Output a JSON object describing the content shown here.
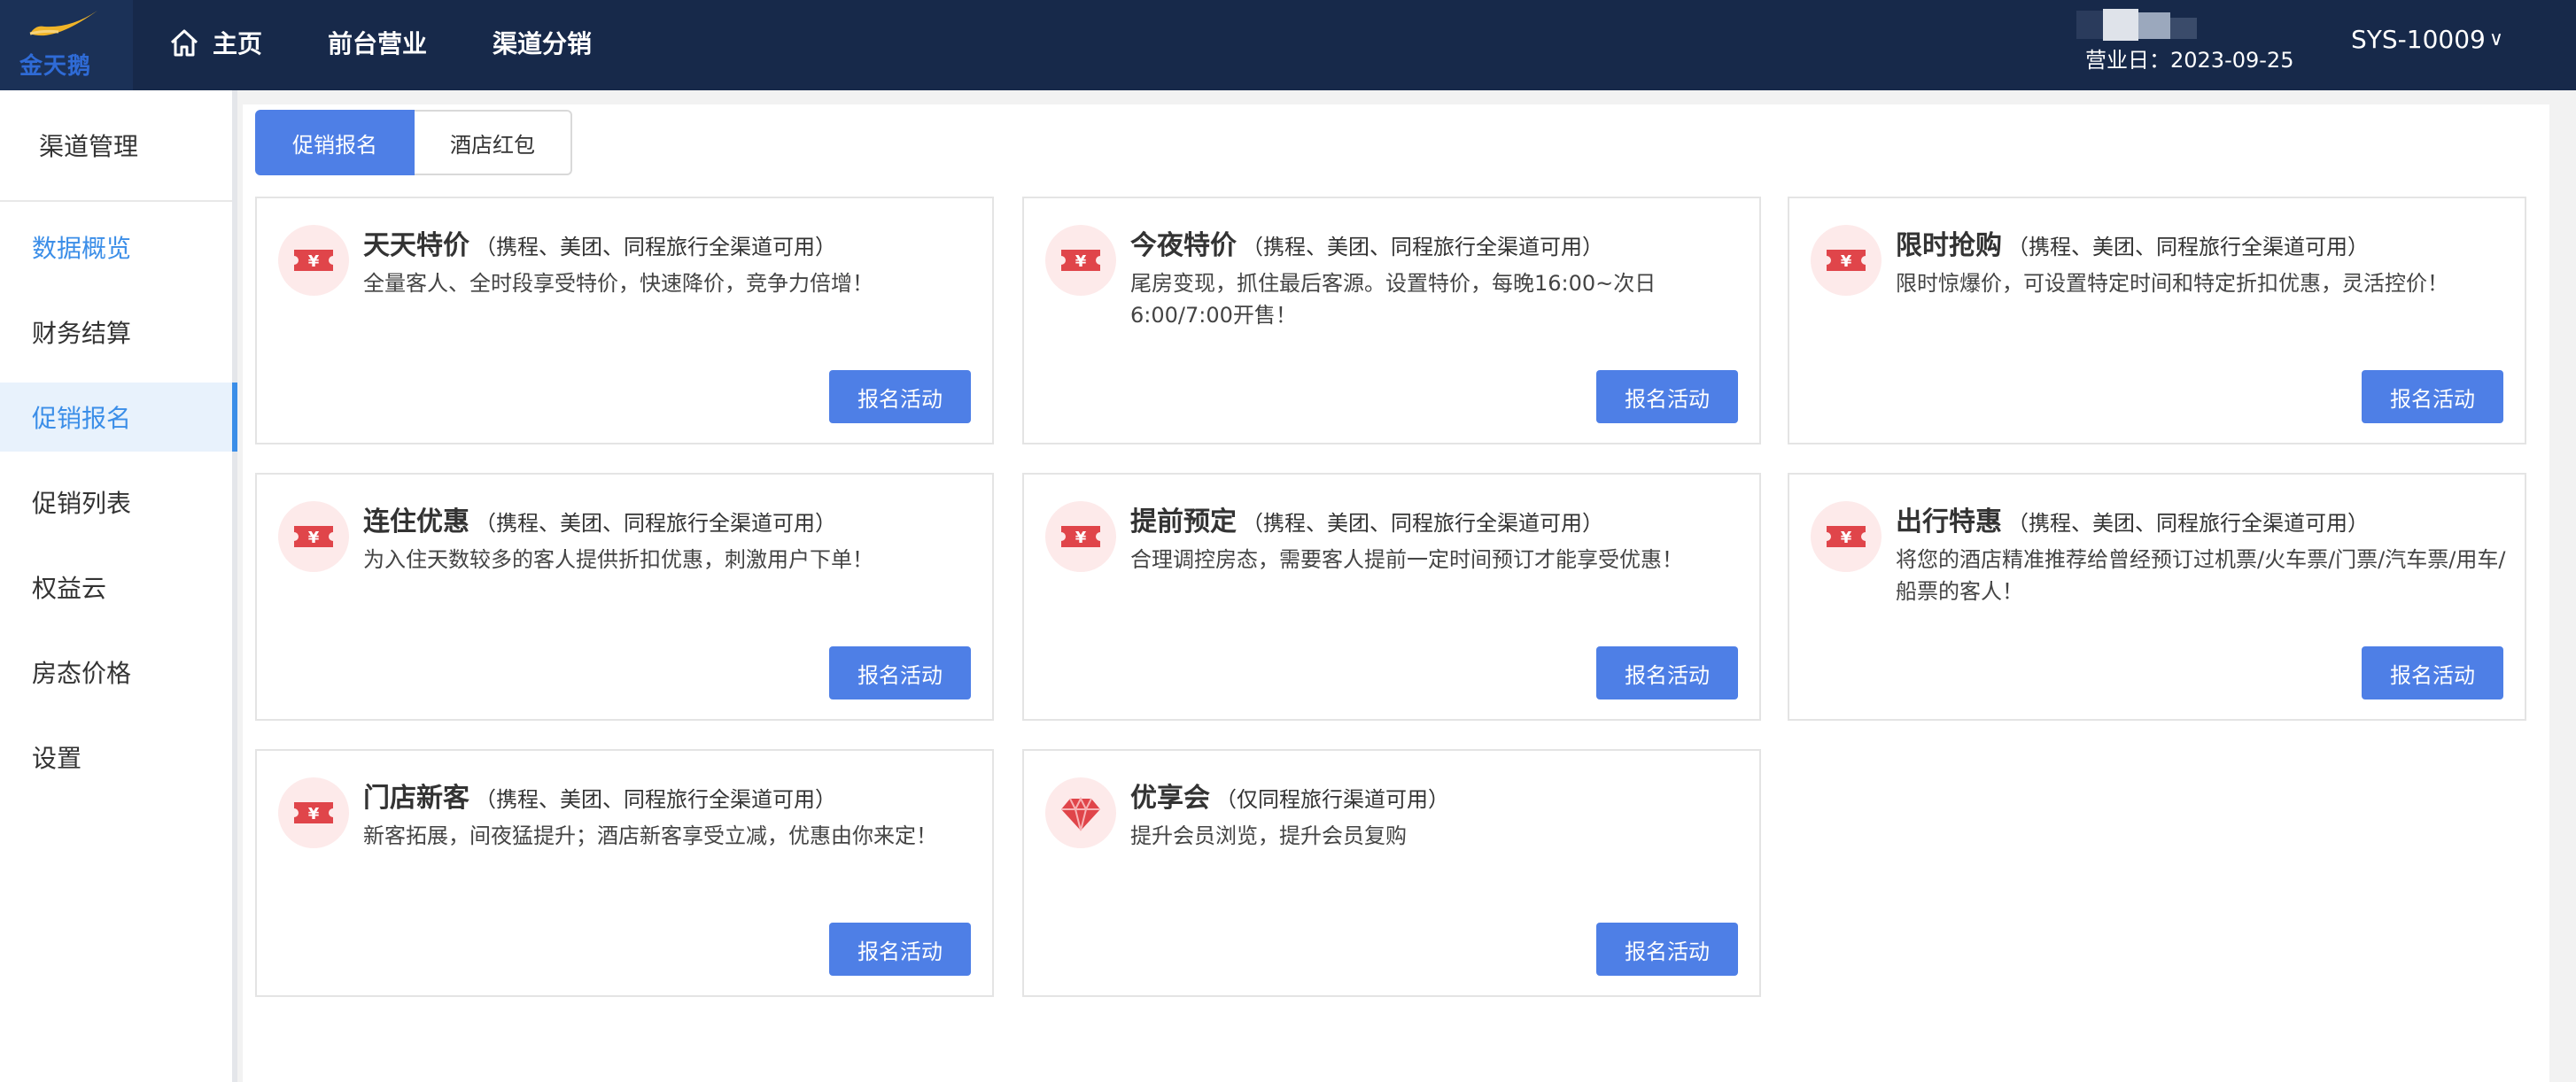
{
  "header": {
    "brand": "金天鹅",
    "nav": [
      {
        "label": "主页"
      },
      {
        "label": "前台营业"
      },
      {
        "label": "渠道分销"
      }
    ],
    "business_date": "营业日：2023-09-25",
    "user": "SYS-10009"
  },
  "sidebar": {
    "title": "渠道管理",
    "items": [
      {
        "label": "数据概览"
      },
      {
        "label": "财务结算"
      },
      {
        "label": "促销报名"
      },
      {
        "label": "促销列表"
      },
      {
        "label": "权益云"
      },
      {
        "label": "房态价格"
      },
      {
        "label": "设置"
      }
    ]
  },
  "tabs": [
    {
      "label": "促销报名"
    },
    {
      "label": "酒店红包"
    }
  ],
  "cards": [
    {
      "title": "天天特价",
      "subtitle": "（携程、美团、同程旅行全渠道可用）",
      "desc": "全量客人、全时段享受特价，快速降价，竞争力倍增！",
      "button": "报名活动",
      "icon": "ticket-icon"
    },
    {
      "title": "今夜特价",
      "subtitle": "（携程、美团、同程旅行全渠道可用）",
      "desc": "尾房变现，抓住最后客源。设置特价，每晚16:00~次日6:00/7:00开售！",
      "button": "报名活动",
      "icon": "ticket-icon"
    },
    {
      "title": "限时抢购",
      "subtitle": "（携程、美团、同程旅行全渠道可用）",
      "desc": "限时惊爆价，可设置特定时间和特定折扣优惠，灵活控价！",
      "button": "报名活动",
      "icon": "ticket-icon"
    },
    {
      "title": "连住优惠",
      "subtitle": "（携程、美团、同程旅行全渠道可用）",
      "desc": "为入住天数较多的客人提供折扣优惠，刺激用户下单！",
      "button": "报名活动",
      "icon": "ticket-icon"
    },
    {
      "title": "提前预定",
      "subtitle": "（携程、美团、同程旅行全渠道可用）",
      "desc": "合理调控房态，需要客人提前一定时间预订才能享受优惠！",
      "button": "报名活动",
      "icon": "ticket-icon"
    },
    {
      "title": "出行特惠",
      "subtitle": "（携程、美团、同程旅行全渠道可用）",
      "desc": "将您的酒店精准推荐给曾经预订过机票/火车票/门票/汽车票/用车/船票的客人！",
      "button": "报名活动",
      "icon": "ticket-icon"
    },
    {
      "title": "门店新客",
      "subtitle": "（携程、美团、同程旅行全渠道可用）",
      "desc": "新客拓展，间夜猛提升；酒店新客享受立减，优惠由你来定！",
      "button": "报名活动",
      "icon": "ticket-icon"
    },
    {
      "title": "优享会",
      "subtitle": "（仅同程旅行渠道可用）",
      "desc": "提升会员浏览，提升会员复购",
      "button": "报名活动",
      "icon": "diamond-icon"
    }
  ],
  "colors": {
    "topbar": "#17294a",
    "accent": "#4e7fe6",
    "sidebar_active": "#3b8ee8",
    "icon_red": "#e0454a"
  }
}
